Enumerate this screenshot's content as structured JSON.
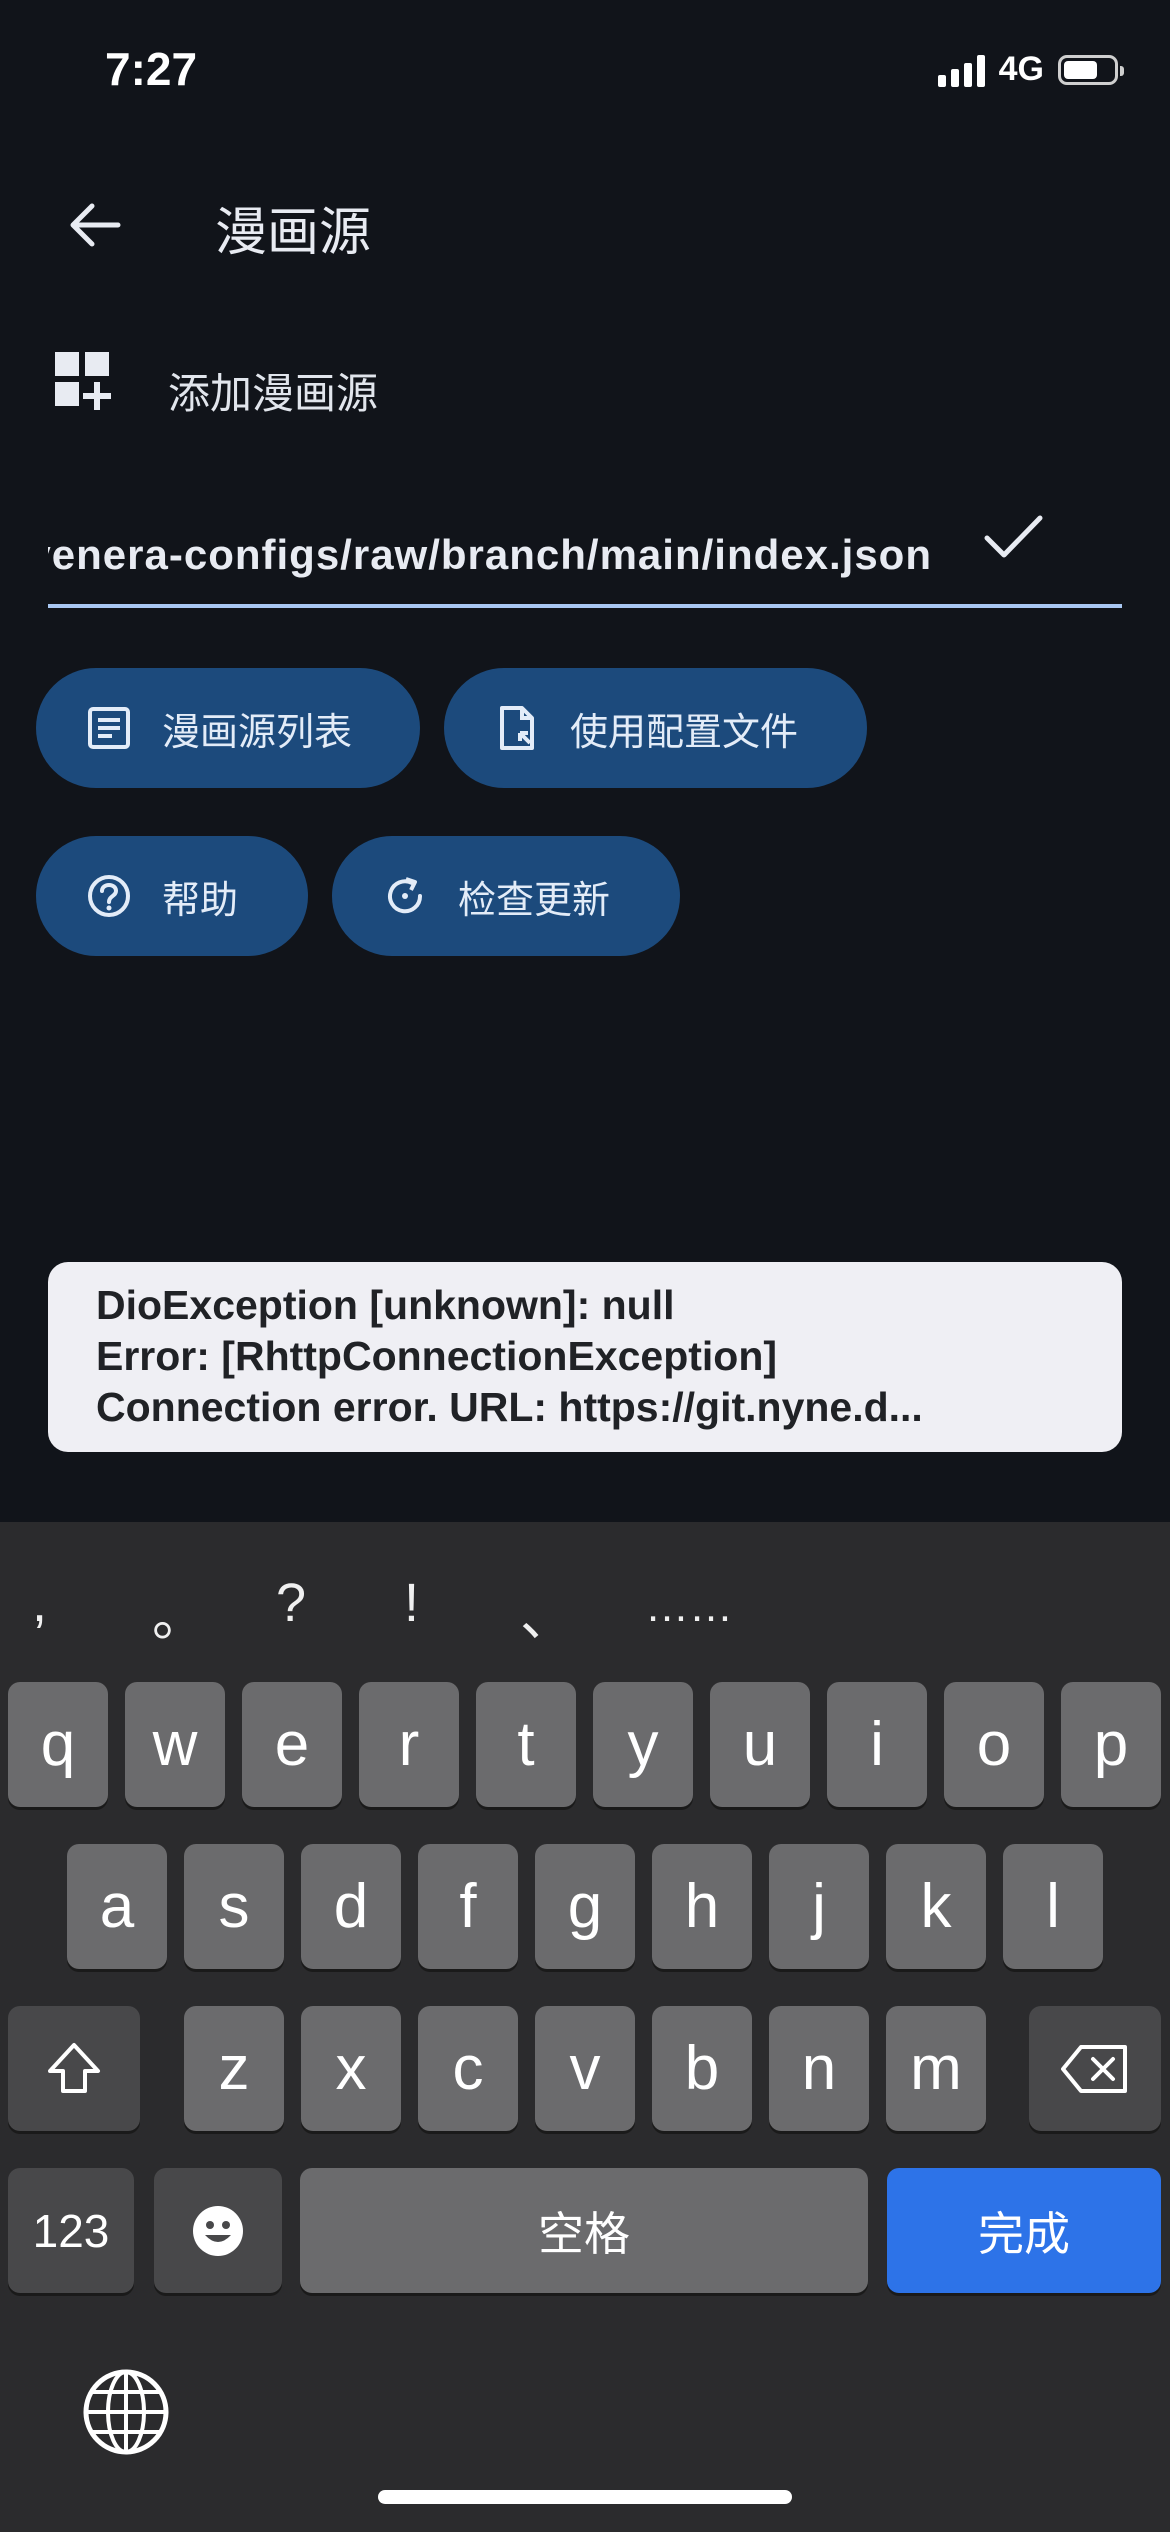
{
  "status": {
    "time": "7:27",
    "network": "4G"
  },
  "appbar": {
    "title": "漫画源"
  },
  "add_source": {
    "label": "添加漫画源"
  },
  "url_input": {
    "value": "https://git.nyne.dev/nyne/venera-configs/raw/branch/main/index.json"
  },
  "buttons": {
    "source_list": "漫画源列表",
    "use_config": "使用配置文件",
    "help": "帮助",
    "check_update": "检查更新"
  },
  "toast": {
    "line1": "DioException [unknown]: null",
    "line2": "Error: [RhttpConnectionException]",
    "line3": "Connection error. URL: https://git.nyne.d..."
  },
  "keyboard": {
    "suggestions": [
      ",",
      "。",
      "?",
      "!",
      "、",
      "……"
    ],
    "row1": [
      "q",
      "w",
      "e",
      "r",
      "t",
      "y",
      "u",
      "i",
      "o",
      "p"
    ],
    "row2": [
      "a",
      "s",
      "d",
      "f",
      "g",
      "h",
      "j",
      "k",
      "l"
    ],
    "row3": [
      "z",
      "x",
      "c",
      "v",
      "b",
      "n",
      "m"
    ],
    "numbers_key": "123",
    "space_key": "空格",
    "done_key": "完成",
    "icons": {
      "shift": "shift-icon",
      "backspace": "backspace-icon",
      "emoji": "emoji-icon",
      "globe": "globe-icon"
    }
  },
  "colors": {
    "background": "#11141a",
    "chip": "#1c4a7c",
    "accent": "#a9c7f2",
    "done_key": "#2d73e8"
  }
}
